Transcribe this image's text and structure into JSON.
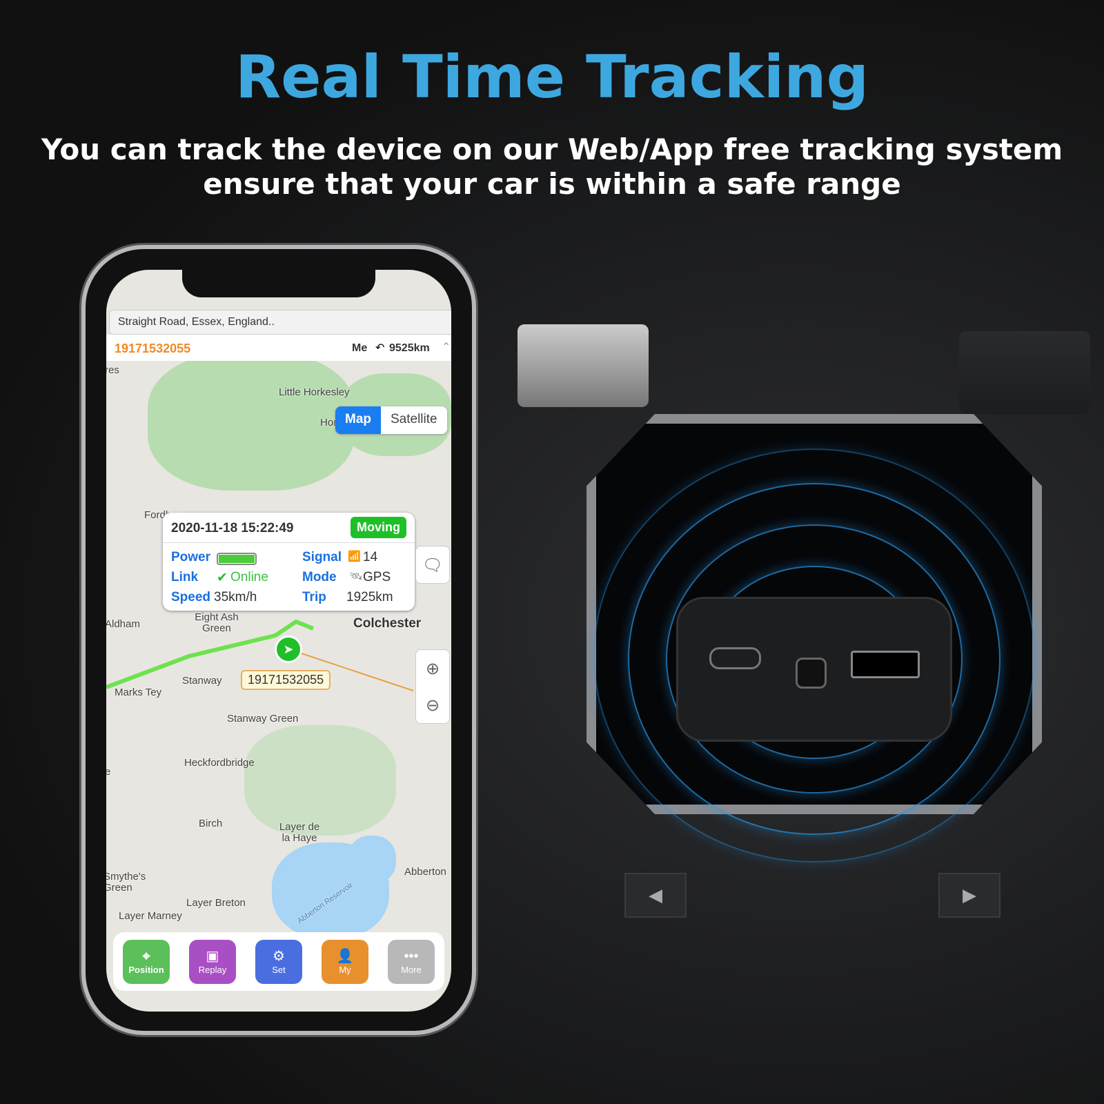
{
  "headline": "Real Time Tracking",
  "subtitle_line1": "You can track the device on our Web/App free tracking system",
  "subtitle_line2": "ensure that your car is within a safe range",
  "app": {
    "address": "Straight Road, Essex, England..",
    "device_id": "19171532055",
    "me_label": "Me",
    "distance": "9525km",
    "map_toggle": {
      "map": "Map",
      "satellite": "Satellite",
      "selected": "Map"
    },
    "popup": {
      "timestamp": "2020-11-18 15:22:49",
      "status": "Moving",
      "power_label": "Power",
      "power_level": 100,
      "signal_label": "Signal",
      "signal_value": "14",
      "link_label": "Link",
      "link_value": "Online",
      "mode_label": "Mode",
      "mode_value": "GPS",
      "speed_label": "Speed",
      "speed_value": "35km/h",
      "trip_label": "Trip",
      "trip_value": "1925km"
    },
    "marker_label": "19171532055",
    "map_labels": [
      "Little Horkesley",
      "Horkesley",
      "Fordham",
      "Aldham",
      "Eight Ash Green",
      "Colchester",
      "Stanway",
      "Marks Tey",
      "Stanway Green",
      "Heckfordbridge",
      "Birch",
      "Layer de la Haye",
      "Smythe's Green",
      "Abberton",
      "Layer Breton",
      "Layer Marney",
      "Abberton Reservoir",
      "res",
      "e"
    ],
    "tabs": [
      {
        "label": "Position",
        "icon": "location-pin-icon",
        "color": "#5cc05a"
      },
      {
        "label": "Replay",
        "icon": "video-icon",
        "color": "#a94fc4"
      },
      {
        "label": "Set",
        "icon": "gear-icon",
        "color": "#4a6ee0"
      },
      {
        "label": "My",
        "icon": "user-icon",
        "color": "#e8902e"
      },
      {
        "label": "More",
        "icon": "more-dots-icon",
        "color": "#b8b8b8"
      }
    ],
    "colors": {
      "accent": "#1a6fe0",
      "id": "#f08a24",
      "moving": "#1fbf2a",
      "track": "#6de24e"
    }
  }
}
